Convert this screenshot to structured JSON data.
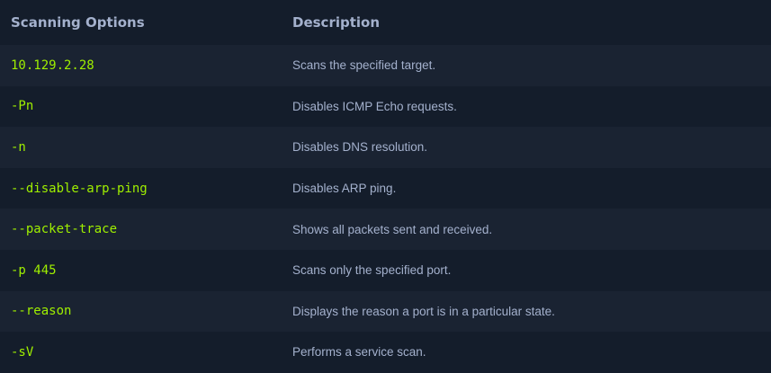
{
  "table": {
    "headers": {
      "option": "Scanning Options",
      "description": "Description"
    },
    "rows": [
      {
        "option": "10.129.2.28",
        "description": "Scans the specified target."
      },
      {
        "option": "-Pn",
        "description": "Disables ICMP Echo requests."
      },
      {
        "option": "-n",
        "description": "Disables DNS resolution."
      },
      {
        "option": "--disable-arp-ping",
        "description": "Disables ARP ping."
      },
      {
        "option": "--packet-trace",
        "description": "Shows all packets sent and received."
      },
      {
        "option": "-p 445",
        "description": "Scans only the specified port."
      },
      {
        "option": "--reason",
        "description": "Displays the reason a port is in a particular state."
      },
      {
        "option": "-sV",
        "description": "Performs a service scan."
      }
    ]
  },
  "colors": {
    "background": "#141d2b",
    "row_alt": "#1a2332",
    "option_text": "#9fef00",
    "description_text": "#a4b1cd"
  }
}
